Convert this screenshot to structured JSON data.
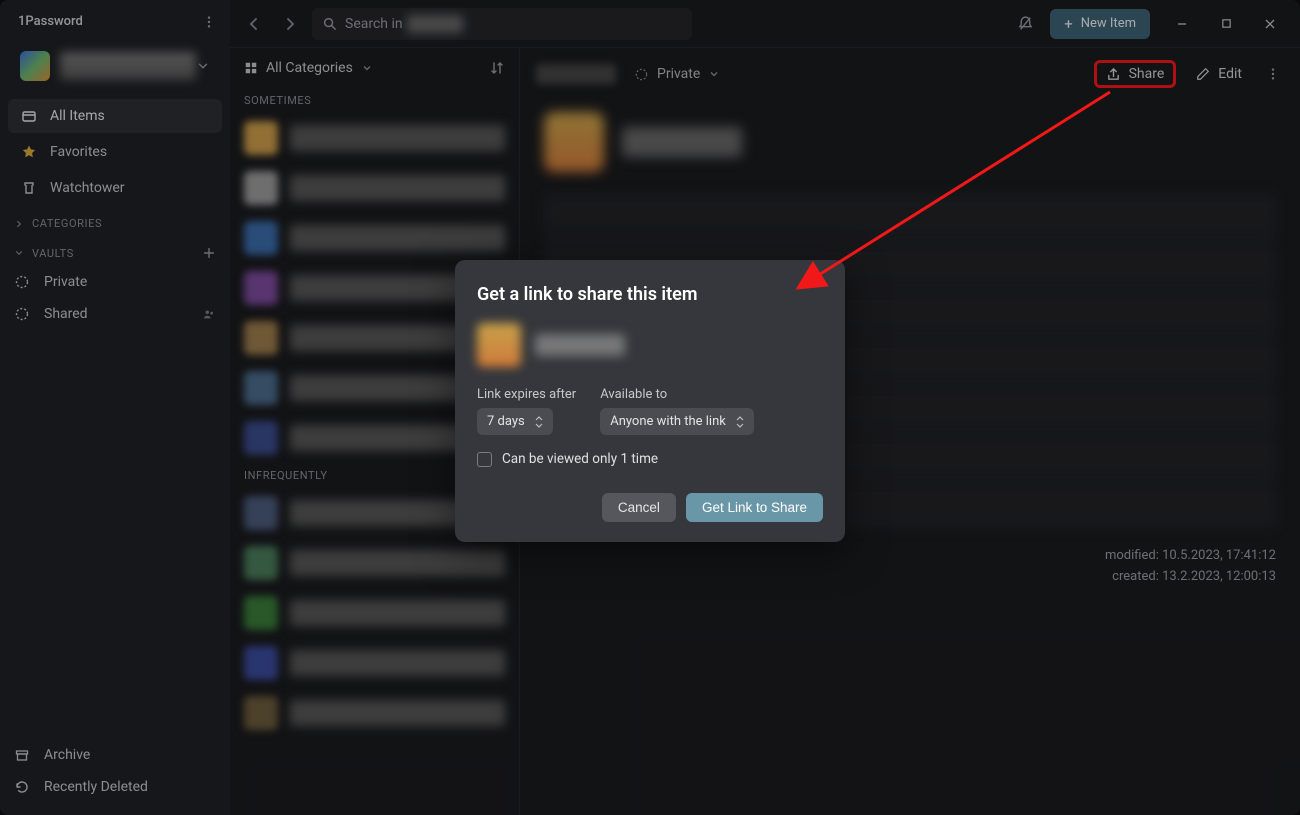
{
  "brand": "1Password",
  "account": {
    "chevron": "⌄"
  },
  "nav": {
    "all_items": "All Items",
    "favorites": "Favorites",
    "watchtower": "Watchtower"
  },
  "sections": {
    "categories": "CATEGORIES",
    "vaults": "VAULTS"
  },
  "vaults": {
    "private": "Private",
    "shared": "Shared"
  },
  "bottom": {
    "archive": "Archive",
    "recently_deleted": "Recently Deleted"
  },
  "topbar": {
    "search_prefix": "Search in",
    "new_item": "New Item"
  },
  "list": {
    "filter": "All Categories",
    "section_sometimes": "SOMETIMES",
    "section_infrequently": "INFREQUENTLY"
  },
  "detail": {
    "vault": "Private",
    "share": "Share",
    "edit": "Edit",
    "modified_label": "modified:",
    "modified_value": "10.5.2023, 17:41:12",
    "created_label": "created:",
    "created_value": "13.2.2023, 12:00:13"
  },
  "modal": {
    "title": "Get a link to share this item",
    "link_expires_label": "Link expires after",
    "link_expires_value": "7 days",
    "available_label": "Available to",
    "available_value": "Anyone with the link",
    "checkbox": "Can be viewed only 1 time",
    "cancel": "Cancel",
    "get_link": "Get Link to Share"
  },
  "colors": {
    "annotation": "#f01818",
    "primary_btn": "#6a97a8"
  }
}
